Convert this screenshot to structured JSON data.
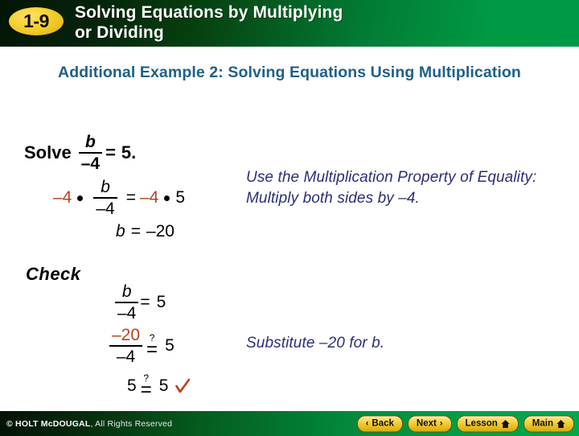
{
  "header": {
    "badge": "1-9",
    "title_line1": "Solving Equations by Multiplying",
    "title_line2": "or Dividing",
    "bg_dark": "#041505",
    "bg_bright": "#009944",
    "badge_color": "#f5cf2e",
    "title_color": "#ffffff"
  },
  "subtitle": {
    "line1": "Additional Example 2: Solving Equations Using",
    "line2": "Multiplication",
    "color": "#1f6089"
  },
  "solution": {
    "solve_label": "Solve",
    "problem": {
      "numerator": "b",
      "denominator": "–4",
      "equals": "=",
      "rhs": "5",
      "period": "."
    },
    "step1": {
      "left_factor": "–4",
      "dot": "•",
      "numerator": "b",
      "denominator": "–4",
      "equals": "=",
      "right_factor": "–4",
      "right_dot": "•",
      "right_value": "5"
    },
    "step2": {
      "variable": "b",
      "equals": "=",
      "value": "–20"
    },
    "note": "Use the Multiplication Property of Equality: Multiply both sides by –4.",
    "note_color": "#2b2f78",
    "red_color": "#b8401f"
  },
  "check": {
    "label": "Check",
    "line1": {
      "numerator": "b",
      "denominator": "–4",
      "equals": "=",
      "rhs": "5"
    },
    "line2": {
      "numerator": "–20",
      "denominator": "–4",
      "question": "?",
      "equals": "=",
      "rhs": "5"
    },
    "line3": {
      "lhs": "5",
      "question": "?",
      "equals": "=",
      "rhs": "5",
      "checkmark": "✓"
    },
    "note": "Substitute –20 for b."
  },
  "footer": {
    "copyright_brand": "© HOLT McDOUGAL",
    "copyright_rest": ", All Rights Reserved",
    "buttons": [
      {
        "label": "Back",
        "chev": "‹",
        "chev_side": "left",
        "home": false
      },
      {
        "label": "Next",
        "chev": "›",
        "chev_side": "right",
        "home": false
      },
      {
        "label": "Lesson",
        "chev": "",
        "chev_side": "",
        "home": true
      },
      {
        "label": "Main",
        "chev": "",
        "chev_side": "",
        "home": true
      }
    ],
    "button_color": "#f3cf3f"
  }
}
